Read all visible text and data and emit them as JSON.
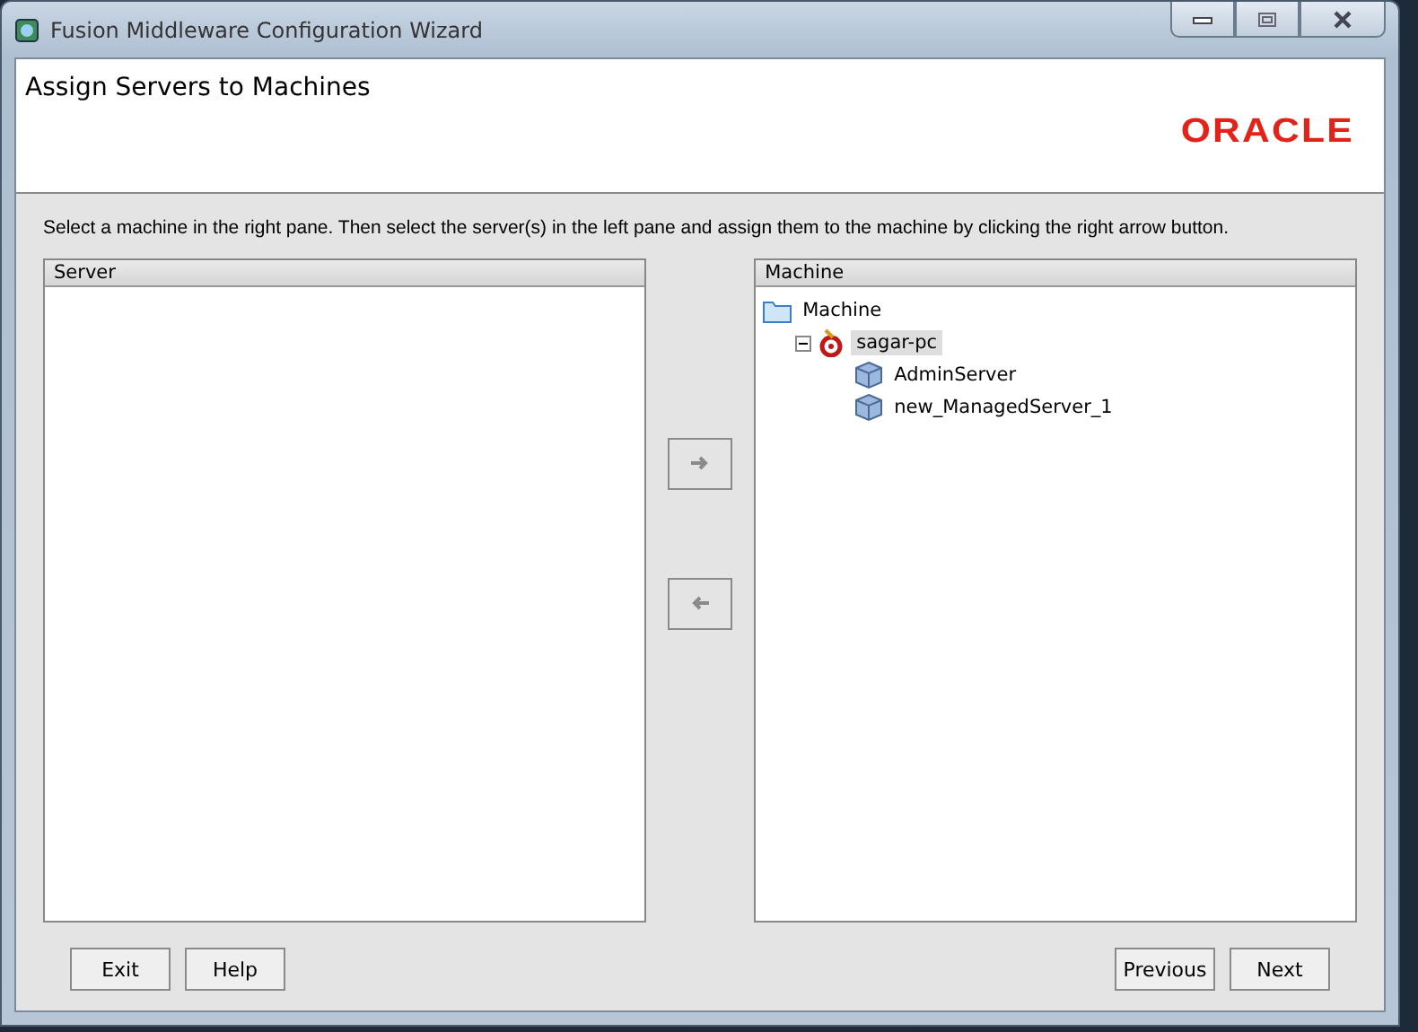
{
  "window": {
    "title": "Fusion Middleware Configuration Wizard"
  },
  "header": {
    "title": "Assign Servers to Machines",
    "logo": "ORACLE"
  },
  "instruction": "Select a machine in the right pane. Then select the server(s) in the left pane and assign them to the machine by clicking the right arrow button.",
  "server_pane": {
    "title": "Server"
  },
  "transfer_buttons": [
    {
      "kind": "right",
      "disabled": true
    },
    {
      "kind": "left",
      "disabled": true
    }
  ],
  "machine_pane": {
    "title": "Machine",
    "tree": [
      {
        "label": "Machine",
        "kind": "folder",
        "selected": false,
        "children": [
          {
            "label": "sagar-pc",
            "kind": "machine",
            "selected": true,
            "expanded": true,
            "children": [
              {
                "label": "AdminServer",
                "kind": "server",
                "selected": false
              },
              {
                "label": "new_ManagedServer_1",
                "kind": "server",
                "selected": false
              }
            ]
          }
        ]
      }
    ]
  },
  "left_buttons": [
    {
      "label": "Exit"
    },
    {
      "label": "Help"
    }
  ],
  "right_buttons": [
    {
      "label": "Previous"
    },
    {
      "label": "Next"
    }
  ]
}
